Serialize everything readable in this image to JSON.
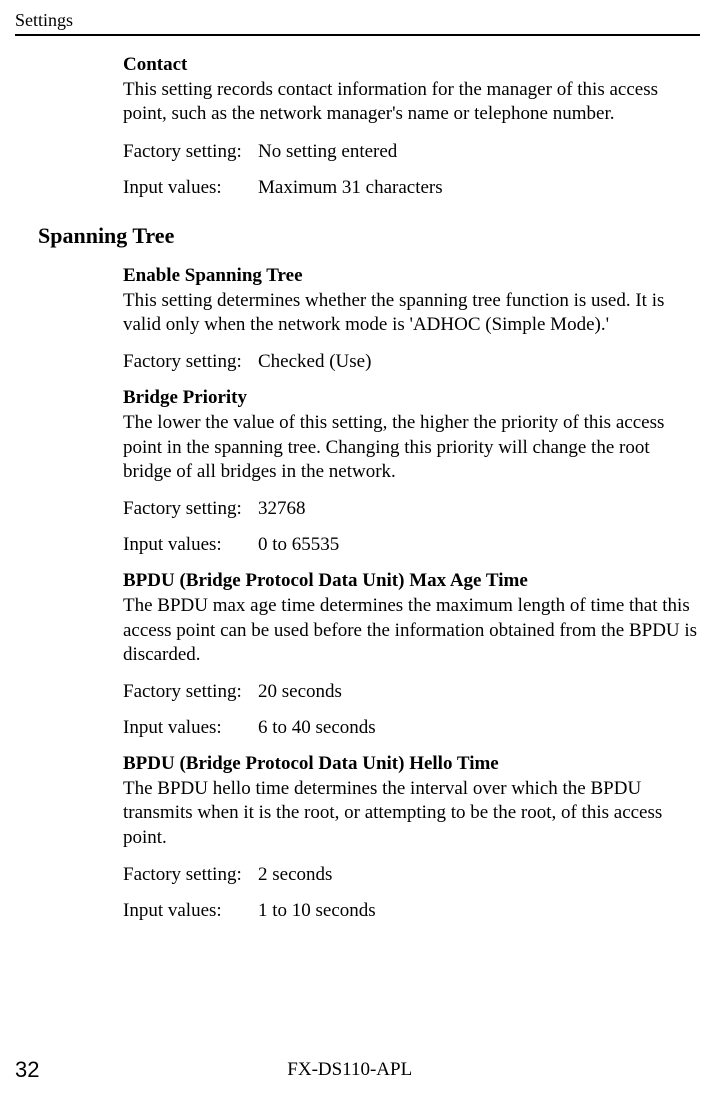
{
  "header": "Settings",
  "contact": {
    "title": "Contact",
    "desc": "This setting records contact information for the manager of this access point, such as the network manager's name or telephone number.",
    "factory_label": "Factory setting:",
    "factory_value": "No setting entered",
    "input_label": "Input values:",
    "input_value": "Maximum 31 characters"
  },
  "spanning_tree_heading": "Spanning Tree",
  "enable_spanning": {
    "title": "Enable Spanning Tree",
    "desc": "This setting determines whether the spanning tree function is used.    It is valid only when the network mode is 'ADHOC (Simple Mode).'",
    "factory_label": "Factory setting:",
    "factory_value": "Checked (Use)"
  },
  "bridge_priority": {
    "title": "Bridge Priority",
    "desc": "The lower the value of this setting, the higher the priority of this access point in the spanning tree.    Changing this priority will change the root bridge of all bridges in the network.",
    "factory_label": "Factory setting:",
    "factory_value": "32768",
    "input_label": "Input values:",
    "input_value": "0 to 65535"
  },
  "bpdu_max": {
    "title": "BPDU (Bridge Protocol Data Unit) Max Age Time",
    "desc": "The BPDU max age time determines the maximum length of time that this access point can be used before the information obtained from the BPDU is discarded.",
    "factory_label": "Factory setting:",
    "factory_value": "20 seconds",
    "input_label": "Input values:",
    "input_value": "6 to 40 seconds"
  },
  "bpdu_hello": {
    "title": "BPDU (Bridge Protocol Data Unit) Hello Time",
    "desc": "The BPDU hello time determines the interval over which the BPDU transmits when it is the root, or attempting to be the root, of this access point.",
    "factory_label": "Factory setting:",
    "factory_value": "2 seconds",
    "input_label": "Input values:",
    "input_value": "1 to 10 seconds"
  },
  "footer": {
    "page_number": "32",
    "model": "FX-DS110-APL"
  }
}
